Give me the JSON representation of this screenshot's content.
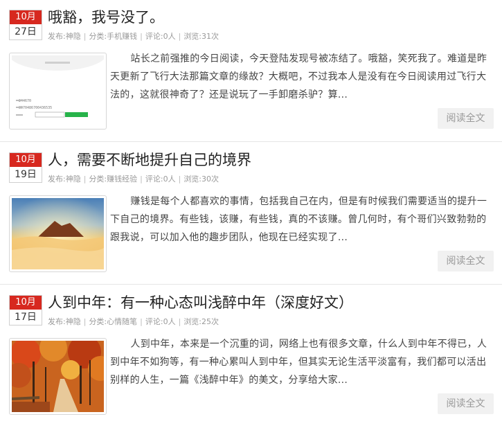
{
  "labels": {
    "author_prefix": "发布:",
    "category_prefix": "分类:",
    "comments_prefix": "评论:",
    "views_prefix": "浏览:",
    "read_more": "阅读全文"
  },
  "colors": {
    "date_month_bg": "#d7281f",
    "meta_text": "#999999",
    "read_more_bg": "#f1f1f1"
  },
  "posts": [
    {
      "month": "10月",
      "day": "27日",
      "title": "哦豁，我号没了。",
      "author": "神隐",
      "category": "手机赚钱",
      "comments": "0人",
      "views": "31次",
      "excerpt": "站长之前强推的今日阅读，今天登陆发现号被冻结了。哦豁，笑死我了。难道是昨天更新了飞行大法那篇文章的缘故？大概吧，不过我本人是没有在今日阅读用过飞行大法的，这就很神奇了？还是说玩了一手卸磨杀驴？算...",
      "thumbnail": "app-screenshot-thumbnail"
    },
    {
      "month": "10月",
      "day": "19日",
      "title": "人，需要不断地提升自己的境界",
      "author": "神隐",
      "category": "赚钱经验",
      "comments": "0人",
      "views": "30次",
      "excerpt": "赚钱是每个人都喜欢的事情，包括我自己在内，但是有时候我们需要适当的提升一下自己的境界。有些钱，该赚，有些钱，真的不该赚。曾几何时，有个哥们兴致勃勃的跟我说，可以加入他的趣步团队，他现在已经实现了...",
      "thumbnail": "mountain-sunset-thumbnail"
    },
    {
      "month": "10月",
      "day": "17日",
      "title": "人到中年：有一种心态叫浅醉中年（深度好文）",
      "author": "神隐",
      "category": "心情随笔",
      "comments": "0人",
      "views": "25次",
      "excerpt": "人到中年，本来是一个沉重的词，网络上也有很多文章，什么人到中年不得已，人到中年不如狗等，有一种心累叫人到中年，但其实无论生活平淡富有，我们都可以活出别样的人生，一篇《浅醉中年》的美文，分享给大家...",
      "thumbnail": "autumn-forest-path-thumbnail"
    }
  ],
  "thumb_texts": {
    "line1": "244670",
    "line2": "8970486700436535"
  }
}
